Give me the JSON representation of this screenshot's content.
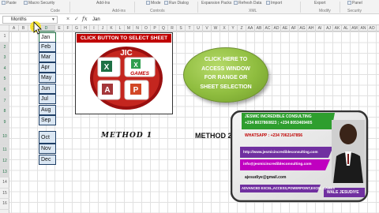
{
  "ribbon": {
    "items": [
      "Paste",
      "Macro Security",
      "Add-ins",
      "Add-Ins",
      "Mode",
      "Run Dialog",
      "Expansion Packs",
      "Refresh Data",
      "Delete Data",
      "Import",
      "Export",
      "Panel"
    ],
    "groups": [
      "Code",
      "Add-ins",
      "Controls",
      "XML",
      "Modify",
      "Security"
    ]
  },
  "formula_bar": {
    "name_box": "Months",
    "cancel_icon": "×",
    "enter_icon": "✓",
    "fx_label": "fx",
    "value": "Jan"
  },
  "columns": [
    "A",
    "B",
    "C",
    "D",
    "E",
    "F",
    "G",
    "H",
    "I",
    "J",
    "K",
    "L",
    "M",
    "N",
    "O",
    "P",
    "Q",
    "R",
    "S",
    "T",
    "U",
    "V",
    "W",
    "X",
    "Y",
    "Z",
    "AA",
    "AB",
    "AC",
    "AD",
    "AE",
    "AF",
    "AG",
    "AH",
    "AI",
    "AJ",
    "AK",
    "AL",
    "AM",
    "AN",
    "AO"
  ],
  "rows": [
    "1",
    "2",
    "3",
    "4",
    "5",
    "6",
    "7",
    "8",
    "9",
    "10",
    "11",
    "12",
    "13",
    "14",
    "15",
    "16"
  ],
  "months": [
    "Jan",
    "Feb",
    "Mar",
    "Apr",
    "May",
    "Jun",
    "Jul",
    "Aug",
    "Sep",
    "Oct",
    "Nov",
    "Dec"
  ],
  "left_picture": {
    "banner": "CLICK BUTTON TO SELECT SHEET",
    "logo_top": "JIC",
    "logo_label": "GAMES"
  },
  "right_button": {
    "lines": [
      "CLICK HERE TO",
      "ACCESS WINDOW",
      "FOR RANGE OR",
      "SHEET SELECTION"
    ]
  },
  "method1": "METHOD 1",
  "method2": "METHOD 2",
  "card": {
    "company": "JESMIC INCREDIBLE CONSULTING",
    "phone1": "+234 8037860823 ; +234 8053469405",
    "phone2": "WHATSAPP : +234 7062147856",
    "website": "http://www.jesmicincredibleconsulting.com",
    "email": "info@jesmicincredibleconsulting.com",
    "skype": "ajesudiye@gmail.com",
    "tagline": "ADVANCED EXCEL,ACCESS,POWERPOINT,EXCEL GAMES",
    "name": "WALE JESUDIYE"
  },
  "colors": {
    "excel_green": "#217346",
    "banner_red": "#c00000",
    "bubble_green": "#8fbd3f",
    "card_purple": "#7030a0",
    "card_magenta": "#c000c0",
    "card_green": "#2e9e2e"
  }
}
